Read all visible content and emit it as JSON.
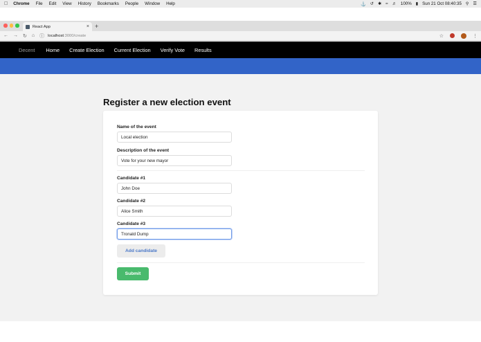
{
  "os_menubar": {
    "app_name": "Chrome",
    "items": [
      "File",
      "Edit",
      "View",
      "History",
      "Bookmarks",
      "People",
      "Window",
      "Help"
    ],
    "battery": "100%",
    "clock": "Sun 21 Oct  08:40:35"
  },
  "browser": {
    "tab_title": "React App",
    "url_host": "localhost",
    "url_path": ":3000/create"
  },
  "navbar": {
    "brand": "Decent",
    "links": [
      "Home",
      "Create Election",
      "Current Election",
      "Verify Vote",
      "Results"
    ]
  },
  "colors": {
    "hero": "#3264c8",
    "submit": "#49ba6d",
    "add_candidate_text": "#4a78c8"
  },
  "page": {
    "title": "Register a new election event"
  },
  "form": {
    "event_name_label": "Name of the event",
    "event_name_value": "Local election",
    "description_label": "Description of the event",
    "description_value": "Vote for your new mayor",
    "candidates": [
      {
        "label": "Candidate #1",
        "value": "John Doe"
      },
      {
        "label": "Candidate #2",
        "value": "Alice Smith"
      },
      {
        "label": "Candidate #3",
        "value": "Tronald Dump"
      }
    ],
    "add_candidate_label": "Add candidate",
    "submit_label": "Submit"
  }
}
